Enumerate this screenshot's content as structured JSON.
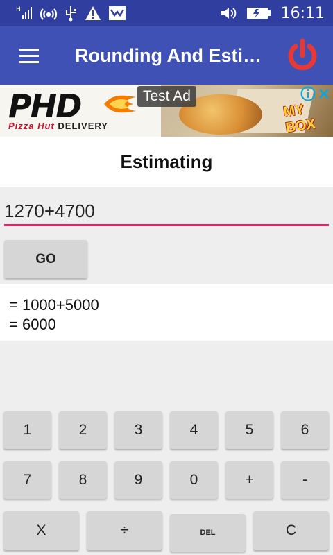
{
  "status_bar": {
    "time": "16:11",
    "icons": [
      "signal-h-icon",
      "wifi-hotspot-icon",
      "usb-icon",
      "warning-icon",
      "photo-icon",
      "volume-icon",
      "battery-charging-icon"
    ]
  },
  "app_bar": {
    "title": "Rounding And Esti…",
    "menu_icon": "hamburger-menu-icon",
    "power_icon": "power-icon",
    "accent": "#3f51b5",
    "power_color": "#e53935"
  },
  "ad": {
    "brand": "PHD",
    "sub_brand": "Pizza Hut",
    "sub_text": "DELIVERY",
    "label": "Test Ad",
    "box_text": "MY BOX"
  },
  "section": {
    "title": "Estimating"
  },
  "input": {
    "value": "1270+4700",
    "underline_color": "#e91e63"
  },
  "go_button": {
    "label": "GO"
  },
  "result": {
    "line1": "= 1000+5000",
    "line2": "= 6000"
  },
  "keypad": {
    "row1": [
      "1",
      "2",
      "3",
      "4",
      "5",
      "6"
    ],
    "row2": [
      "7",
      "8",
      "9",
      "0",
      "+",
      "-"
    ],
    "row3": [
      "X",
      "÷",
      "DEL",
      "C"
    ]
  }
}
